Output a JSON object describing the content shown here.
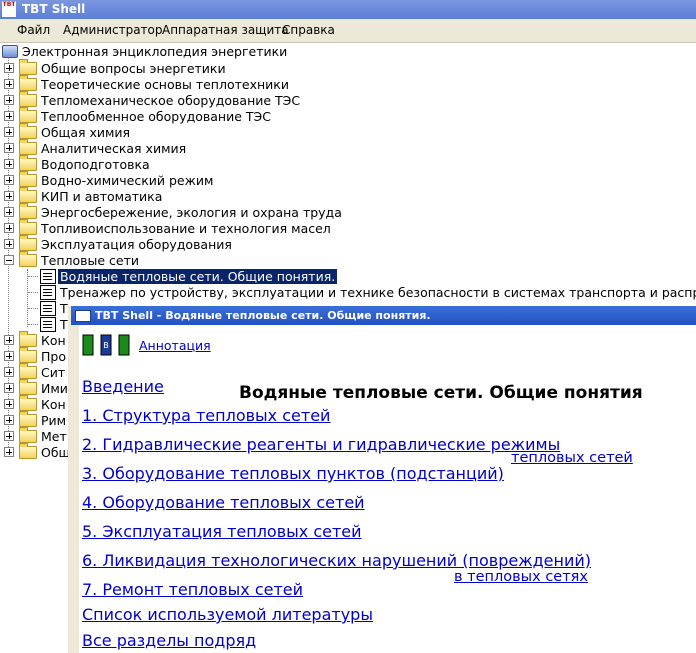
{
  "window": {
    "title": "TBT Shell",
    "icon": "TBT"
  },
  "menu": {
    "items": [
      "Файл",
      "Администратор",
      "Аппаратная защита",
      "Справка"
    ]
  },
  "tree": {
    "root": "Электронная энциклопедия энергетики",
    "folders": [
      "Общие вопросы энергетики",
      "Теоретические основы теплотехники",
      "Тепломеханическое оборудование ТЭС",
      "Теплообменное оборудование ТЭС",
      "Общая химия",
      "Аналитическая химия",
      "Водоподготовка",
      "Водно-химический режим",
      "КИП и автоматика",
      "Энергосбережение, экология и охрана труда",
      "Топливоиспользование и технология масел",
      "Эксплуатация оборудования",
      "Тепловые сети"
    ],
    "expanded_children": [
      "Водяные тепловые сети. Общие понятия.",
      "Тренажер по устройству, эксплуатации и технике безопасности в системах транспорта и распре",
      "Т",
      "Т"
    ],
    "more_folders": [
      "Кон",
      "Про",
      "Сит",
      "Ими",
      "Кон",
      "Рим",
      "Мет",
      "Общ"
    ]
  },
  "dialog": {
    "title": "TBT Shell - Водяные тепловые сети. Общие понятия.",
    "annotation_link": "Аннотация",
    "heading": "Водяные тепловые сети. Общие понятия",
    "links": [
      {
        "text": "Введение"
      },
      {
        "text": "1. Структура тепловых сетей"
      },
      {
        "text": "2. Гидравлические реагенты и гидравлические режимы",
        "cont": "тепловых сетей"
      },
      {
        "text": "3. Оборудование тепловых пунктов (подстанций)"
      },
      {
        "text": "4. Оборудование тепловых сетей"
      },
      {
        "text": "5. Эксплуатация тепловых сетей"
      },
      {
        "text": "6. Ликвидация технологических нарушений (повреждений)",
        "cont": "в тепловых сетях"
      },
      {
        "text": "7. Ремонт тепловых сетей"
      },
      {
        "text": "Список используемой литературы"
      },
      {
        "text": "Все разделы подряд"
      }
    ]
  }
}
